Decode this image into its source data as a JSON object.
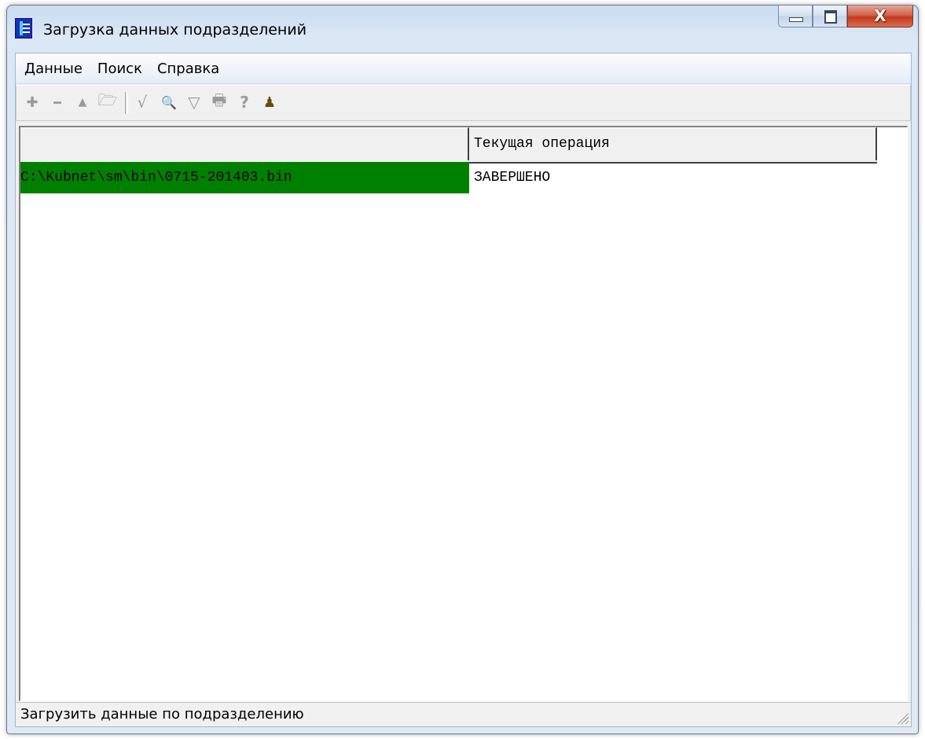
{
  "window": {
    "title": "Загрузка данных подразделений",
    "icon": "app-document-icon",
    "caption_buttons": [
      "minimize-icon",
      "maximize-icon",
      "close-icon"
    ]
  },
  "menu": {
    "items": [
      {
        "label": "Данные"
      },
      {
        "label": "Поиск"
      },
      {
        "label": "Справка"
      }
    ]
  },
  "toolbar": {
    "buttons": [
      {
        "icon": "add-icon",
        "glyph": "✚"
      },
      {
        "icon": "remove-icon",
        "glyph": "━"
      },
      {
        "icon": "move-up-icon",
        "glyph": "▲"
      },
      {
        "icon": "open-folder-icon",
        "glyph": "🗁"
      },
      {
        "icon": "check-icon",
        "glyph": "√"
      },
      {
        "icon": "binoculars-search-icon",
        "glyph": "🔍"
      },
      {
        "icon": "filter-icon",
        "glyph": "▽"
      },
      {
        "icon": "print-icon",
        "glyph": "🖶"
      },
      {
        "icon": "help-icon",
        "glyph": "?"
      },
      {
        "icon": "exit-icon",
        "glyph": "♟"
      }
    ]
  },
  "table": {
    "columns": [
      "",
      "Текущая операция"
    ],
    "rows": [
      {
        "file": "C:\\Kubnet\\sm\\bin\\0715-201403.bin",
        "status": "ЗАВЕРШЕНО"
      }
    ],
    "highlight_color": "#008000"
  },
  "statusbar": {
    "text": "Загрузить данные по подразделению"
  }
}
